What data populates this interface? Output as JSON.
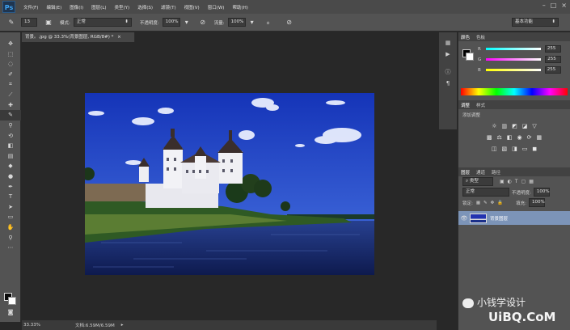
{
  "app": {
    "logo": "Ps",
    "menu": [
      "文件(F)",
      "编辑(E)",
      "图像(I)",
      "图层(L)",
      "类型(Y)",
      "选择(S)",
      "滤镜(T)",
      "视图(V)",
      "窗口(W)",
      "帮助(H)"
    ],
    "window_controls": [
      "–",
      "□",
      "×"
    ]
  },
  "options": {
    "brush_size": "13",
    "mode_label": "模式:",
    "mode_value": "正常",
    "opacity_label": "不透明度:",
    "opacity_value": "100%",
    "flow_label": "流量:",
    "flow_value": "100%",
    "workspace": "基本功能"
  },
  "document": {
    "tab_title": "背景。.jpg @ 33.3%(背景图层, RGB/8#) *",
    "zoom": "33.33%",
    "doc_info": "文档:6.59M/6.59M"
  },
  "panels": {
    "color_tabs": [
      "颜色",
      "色板"
    ],
    "channels": [
      {
        "label": "R",
        "value": "255",
        "color": "#ff3b3b"
      },
      {
        "label": "G",
        "value": "255",
        "color": "#e040e0"
      },
      {
        "label": "B",
        "value": "255",
        "color": "#e8e800"
      }
    ],
    "adjust_tabs": [
      "调整",
      "样式"
    ],
    "adjust_hint": "添加调整",
    "layers_tabs": [
      "图层",
      "通道",
      "路径"
    ],
    "layer_kind": "类型",
    "blend_mode": "正常",
    "layer_opacity_label": "不透明度:",
    "layer_opacity": "100%",
    "lock_label": "锁定:",
    "fill_label": "填充:",
    "fill_value": "100%",
    "layer_name": "背景图层"
  },
  "watermark": {
    "cn": "小钱学设计",
    "en": "UiBQ.CoM"
  }
}
